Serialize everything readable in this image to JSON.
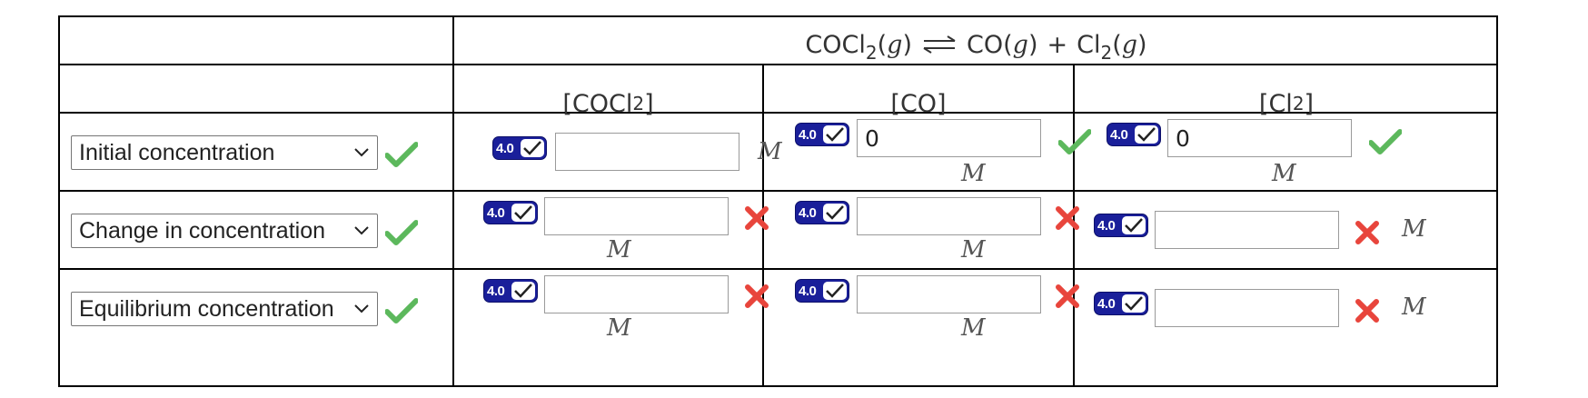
{
  "reaction": {
    "reactant": "COCl",
    "reactant_sub": "2",
    "reactant_phase": "(g)",
    "product1": "CO",
    "product1_phase": "(g)",
    "plus": "+",
    "product2": "Cl",
    "product2_sub": "2",
    "product2_phase": "(g)",
    "phase_letter": "g"
  },
  "columns": [
    {
      "open": "[",
      "base": "COCl",
      "sub": "2",
      "close": "]"
    },
    {
      "open": "[",
      "base": "CO",
      "sub": "",
      "close": "]"
    },
    {
      "open": "[",
      "base": "Cl",
      "sub": "2",
      "close": "]"
    }
  ],
  "rows": [
    {
      "label": "Initial concentration",
      "label_status": "correct",
      "cells": [
        {
          "value": "",
          "status": "",
          "unit": "M"
        },
        {
          "value": "0",
          "status": "correct",
          "unit": "M"
        },
        {
          "value": "0",
          "status": "correct",
          "unit": "M"
        }
      ]
    },
    {
      "label": "Change in concentration",
      "label_status": "correct",
      "cells": [
        {
          "value": "",
          "status": "incorrect",
          "unit": "M"
        },
        {
          "value": "",
          "status": "incorrect",
          "unit": "M"
        },
        {
          "value": "",
          "status": "incorrect",
          "unit": "M"
        }
      ]
    },
    {
      "label": "Equilibrium concentration",
      "label_status": "correct",
      "cells": [
        {
          "value": "",
          "status": "incorrect",
          "unit": "M"
        },
        {
          "value": "",
          "status": "incorrect",
          "unit": "M"
        },
        {
          "value": "",
          "status": "incorrect",
          "unit": "M"
        }
      ]
    }
  ],
  "badge_text": "4.0",
  "colors": {
    "border": "#000000",
    "badge_bg": "#1a1f9a",
    "check_green": "#5cb85c",
    "cross_red": "#e8453c"
  },
  "icons": {
    "check": "check-icon",
    "cross": "cross-icon",
    "chevron": "chevron-down-icon",
    "equilibrium": "equilibrium-arrows-icon",
    "badge": "mathtype-badge-icon"
  }
}
